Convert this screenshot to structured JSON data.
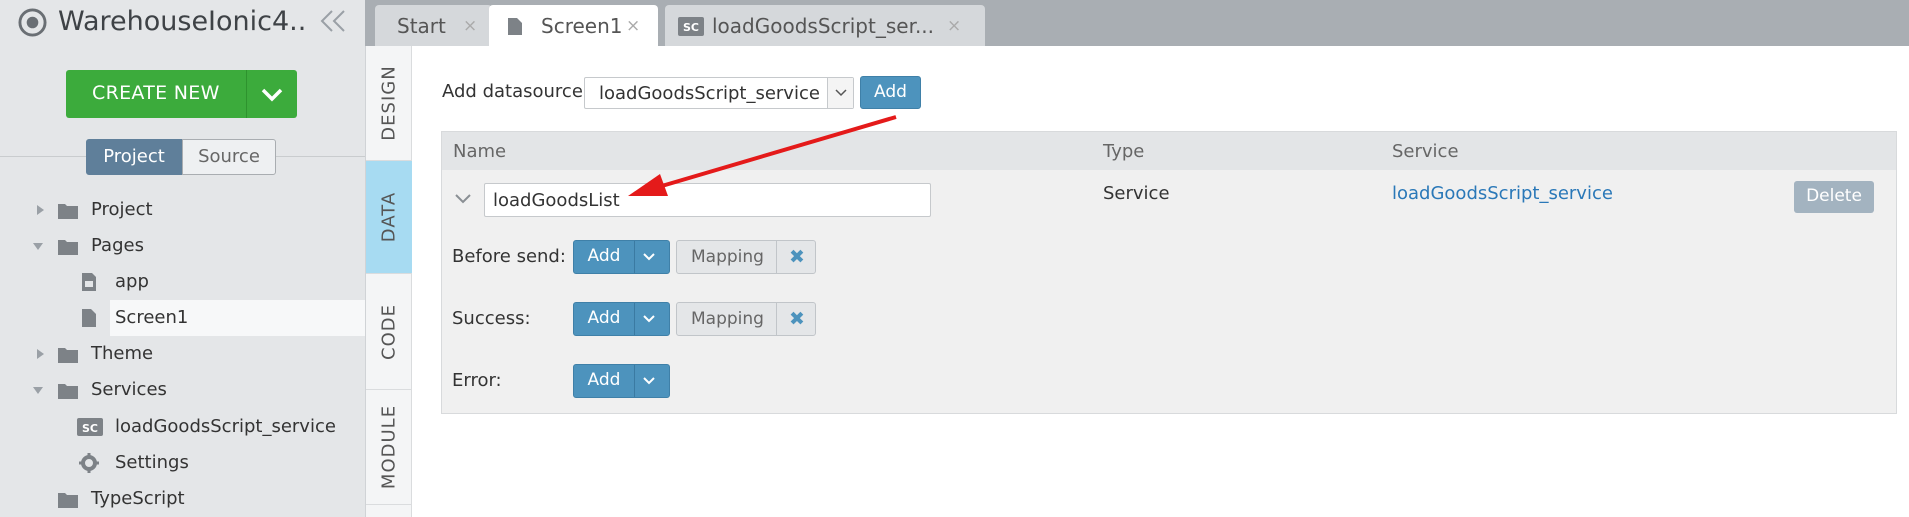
{
  "app": {
    "title": "WarehouseIonic4..."
  },
  "create_button": {
    "label": "CREATE NEW"
  },
  "view_toggle": {
    "project": "Project",
    "source": "Source",
    "selected": "Project"
  },
  "tree": [
    {
      "label": "Project",
      "type": "folder",
      "expanded": false
    },
    {
      "label": "Pages",
      "type": "folder",
      "expanded": true
    },
    {
      "label": "app",
      "type": "page-app"
    },
    {
      "label": "Screen1",
      "type": "page",
      "selected": true
    },
    {
      "label": "Theme",
      "type": "folder",
      "expanded": false
    },
    {
      "label": "Services",
      "type": "folder",
      "expanded": true
    },
    {
      "label": "loadGoodsScript_service",
      "type": "script"
    },
    {
      "label": "Settings",
      "type": "settings"
    },
    {
      "label": "TypeScript",
      "type": "folder"
    }
  ],
  "tabs": [
    {
      "label": "Start",
      "close": "×"
    },
    {
      "label": "Screen1",
      "close": "×",
      "active": true
    },
    {
      "label": "loadGoodsScript_ser...",
      "close": "×",
      "badge": "SC"
    }
  ],
  "side_tabs": [
    "DESIGN",
    "DATA",
    "CODE",
    "MODULE"
  ],
  "active_side_tab": "DATA",
  "datasource": {
    "label": "Add datasource",
    "selected": "loadGoodsScript_service",
    "add_label": "Add"
  },
  "grid": {
    "headers": {
      "name": "Name",
      "type": "Type",
      "service": "Service"
    },
    "row": {
      "name": "loadGoodsList",
      "type": "Service",
      "service": "loadGoodsScript_service",
      "delete_label": "Delete"
    },
    "events": [
      {
        "label": "Before send:",
        "add": "Add",
        "mapping": "Mapping"
      },
      {
        "label": "Success:",
        "add": "Add",
        "mapping": "Mapping"
      },
      {
        "label": "Error:",
        "add": "Add"
      }
    ]
  },
  "colors": {
    "accent": "#4d93bd",
    "create": "#3cab3c",
    "active_side_tab": "#a7dbf2",
    "annotation_arrow": "#e41a1a",
    "link": "#2a78b8"
  }
}
